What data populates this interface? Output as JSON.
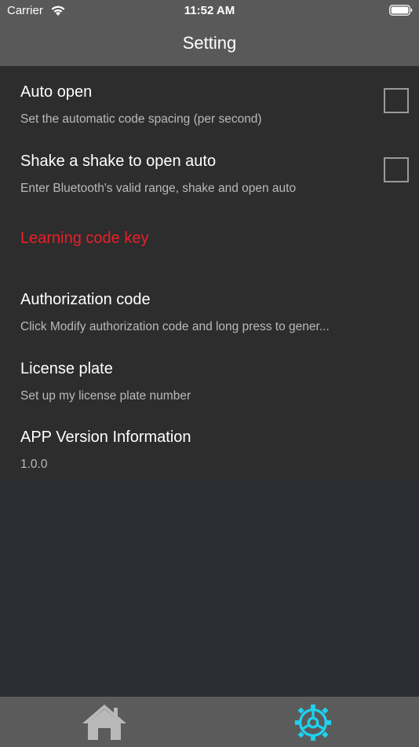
{
  "status_bar": {
    "carrier": "Carrier",
    "time": "11:52 AM",
    "wifi_icon": "wifi-icon",
    "battery_icon": "battery-icon"
  },
  "nav": {
    "title": "Setting"
  },
  "settings": {
    "auto_open": {
      "title": "Auto open",
      "subtitle": "Set the automatic code spacing (per second)",
      "checked": false
    },
    "shake_open": {
      "title": "Shake a shake to open auto",
      "subtitle": "Enter Bluetooth's valid range, shake and open auto",
      "checked": false
    },
    "learning_code_key": {
      "label": "Learning code key",
      "color": "#e8202a"
    },
    "authorization_code": {
      "title": "Authorization code",
      "subtitle": "Click Modify authorization code and long press to gener..."
    },
    "license_plate": {
      "title": "License plate",
      "subtitle": "Set up my license plate number"
    },
    "app_version": {
      "title": "APP Version Information",
      "subtitle": "1.0.0"
    }
  },
  "tabbar": {
    "tabs": [
      {
        "icon": "home-icon",
        "selected": false
      },
      {
        "icon": "gear-icon",
        "selected": true,
        "color": "#1ed2f0"
      }
    ]
  },
  "colors": {
    "header_bg": "#595959",
    "list_bg": "#2d2d2d",
    "page_bg": "#2b2e35",
    "tabbar_bg": "#5b5b5b"
  }
}
